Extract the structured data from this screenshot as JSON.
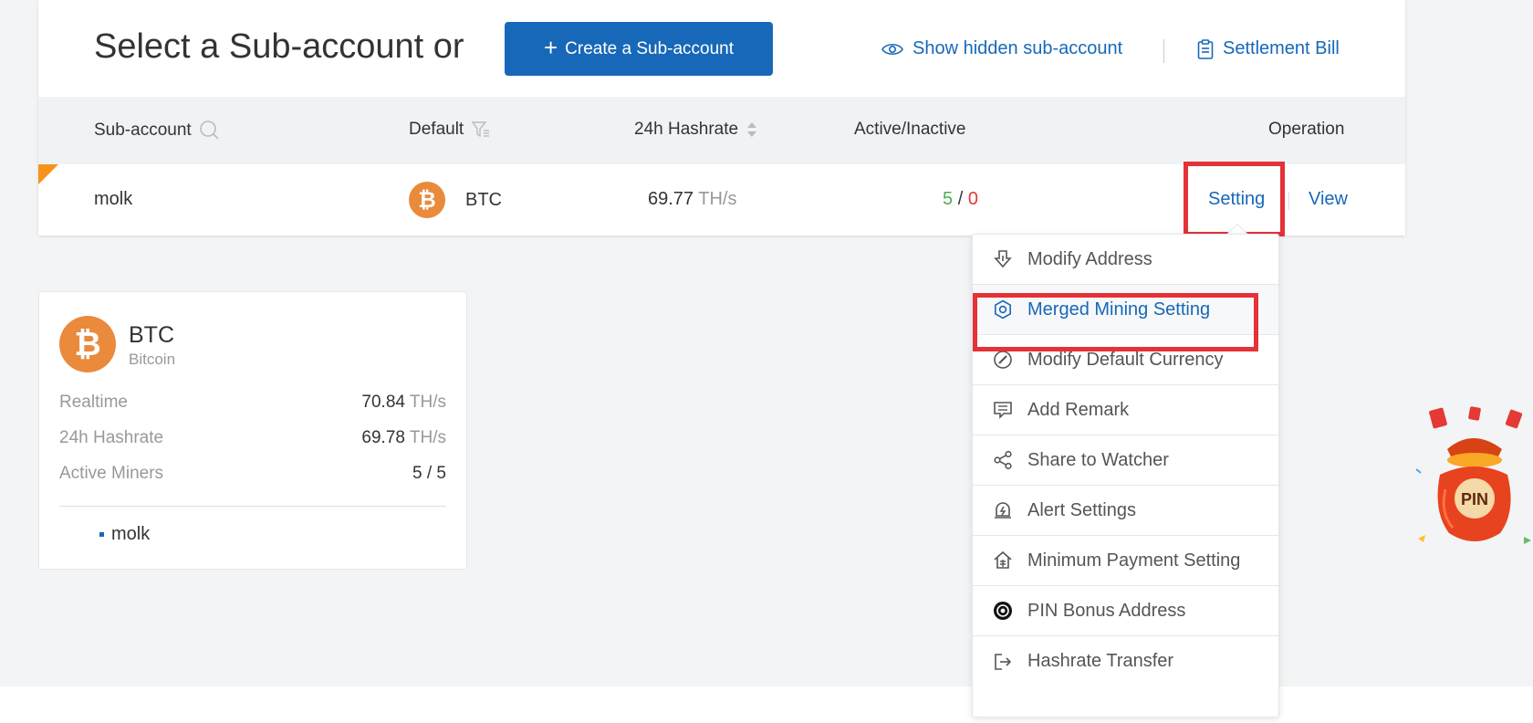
{
  "header": {
    "title": "Select a Sub-account or",
    "create_button": "Create a Sub-account",
    "show_hidden": "Show hidden sub-account",
    "settlement_bill": "Settlement Bill"
  },
  "table": {
    "columns": {
      "subaccount": "Sub-account",
      "default": "Default",
      "hashrate": "24h Hashrate",
      "active_inactive": "Active/Inactive",
      "operation": "Operation"
    },
    "row": {
      "name": "molk",
      "coin": "BTC",
      "hashrate_value": "69.77",
      "hashrate_unit": "TH/s",
      "active": "5",
      "slash": "/",
      "inactive": "0",
      "setting": "Setting",
      "view": "View"
    }
  },
  "card": {
    "coin": "BTC",
    "coin_full": "Bitcoin",
    "stats": [
      {
        "label": "Realtime",
        "value": "70.84",
        "unit": "TH/s"
      },
      {
        "label": "24h Hashrate",
        "value": "69.78",
        "unit": "TH/s"
      },
      {
        "label": "Active Miners",
        "value": "5 / 5",
        "unit": ""
      }
    ],
    "member": "molk"
  },
  "dropdown": {
    "items": [
      {
        "label": "Modify Address",
        "icon": "download-arrow-icon"
      },
      {
        "label": "Merged Mining Setting",
        "icon": "gear-icon"
      },
      {
        "label": "Modify Default Currency",
        "icon": "edit-circle-icon"
      },
      {
        "label": "Add Remark",
        "icon": "comment-icon"
      },
      {
        "label": "Share to Watcher",
        "icon": "share-icon"
      },
      {
        "label": "Alert Settings",
        "icon": "alert-icon"
      },
      {
        "label": "Minimum Payment Setting",
        "icon": "home-payment-icon"
      },
      {
        "label": "PIN Bonus Address",
        "icon": "pin-coin-icon"
      },
      {
        "label": "Hashrate Transfer",
        "icon": "transfer-icon"
      }
    ]
  },
  "decoration": {
    "badge": "PIN"
  },
  "colors": {
    "accent": "#1768b8",
    "highlight": "#e53238",
    "bitcoin": "#e98a3c",
    "active": "#4caf50",
    "inactive": "#e53935"
  }
}
